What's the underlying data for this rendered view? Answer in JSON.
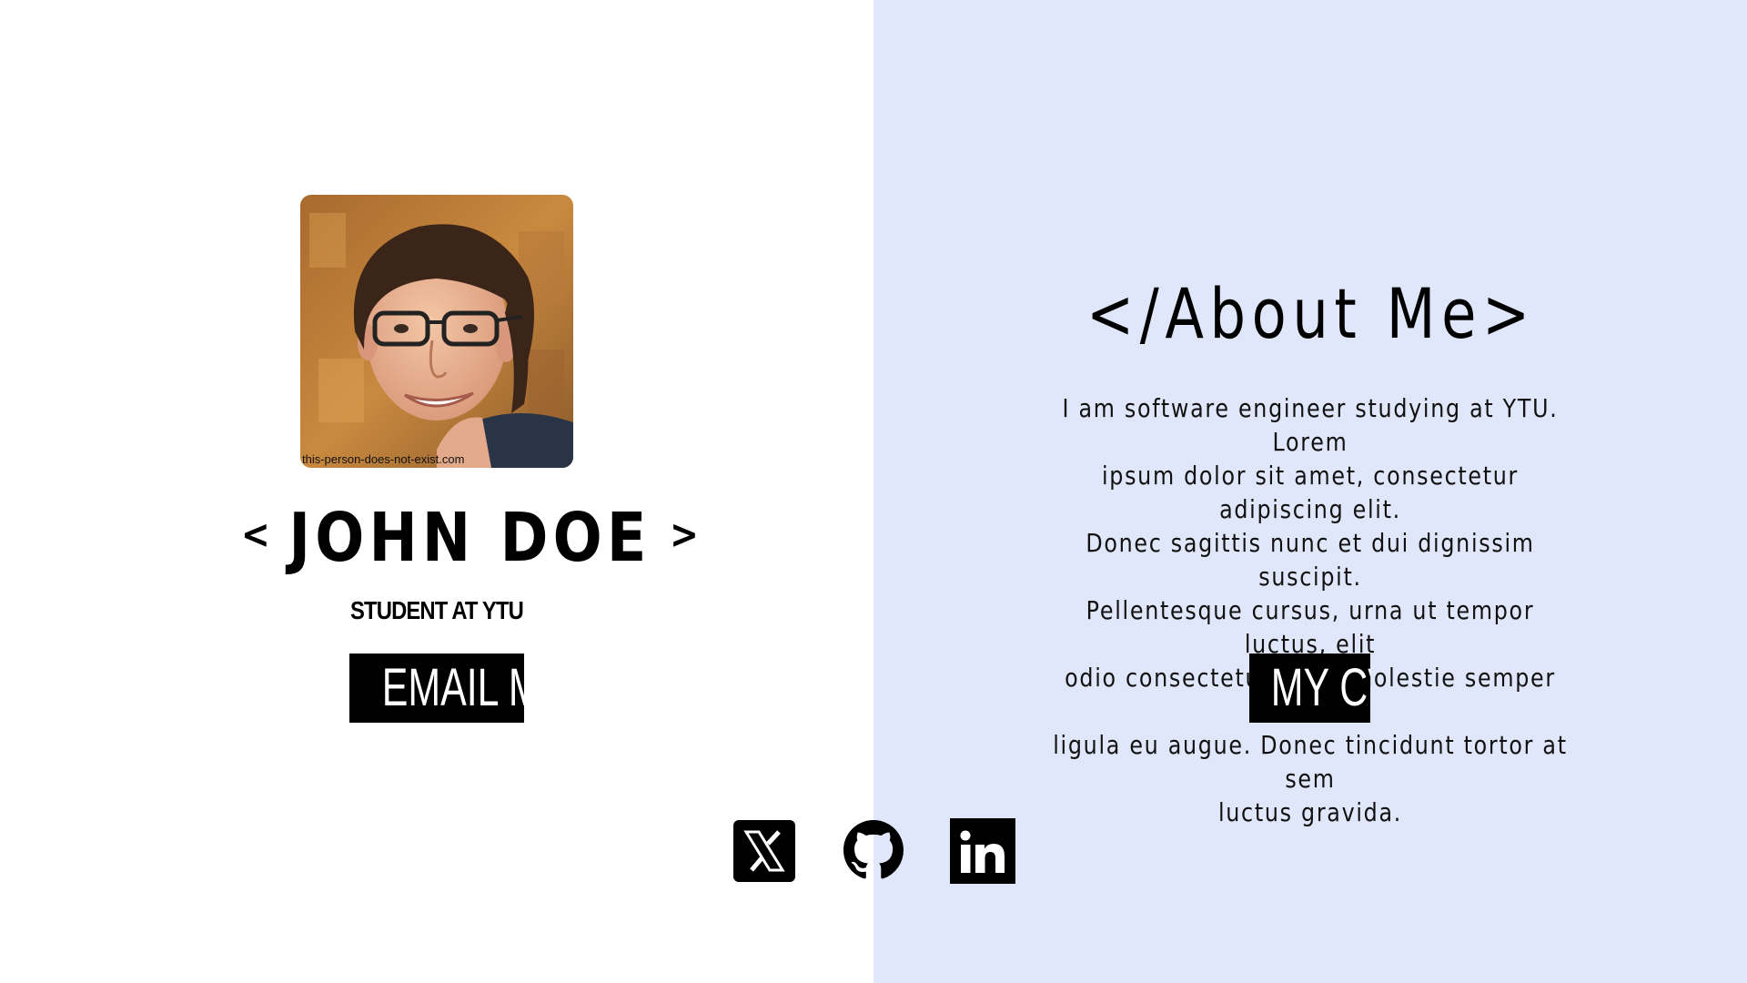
{
  "profile": {
    "photo_credit": "this-person-does-not-exist.com",
    "name_open": "<",
    "name": "JOHN DOE",
    "name_close": ">",
    "subtitle": "STUDENT AT YTU",
    "email_button": "EMAIL ME"
  },
  "about": {
    "heading": "</About Me>",
    "lines": [
      "I am software engineer studying at YTU. Lorem",
      "ipsum dolor sit amet, consectetur adipiscing elit.",
      "Donec sagittis nunc et dui dignissim suscipit.",
      "Pellentesque cursus, urna ut tempor luctus, elit",
      "odio consectetur ante, molestie semper eros",
      "ligula eu augue. Donec tincidunt tortor at sem",
      "luctus gravida."
    ],
    "cv_button": "MY CV"
  },
  "social": {
    "icons": [
      "x-icon",
      "github-icon",
      "linkedin-icon"
    ]
  },
  "colors": {
    "left_background": "#ffffff",
    "right_background": "#e1e7fa",
    "button_background": "#000000",
    "button_text": "#ffffff"
  }
}
